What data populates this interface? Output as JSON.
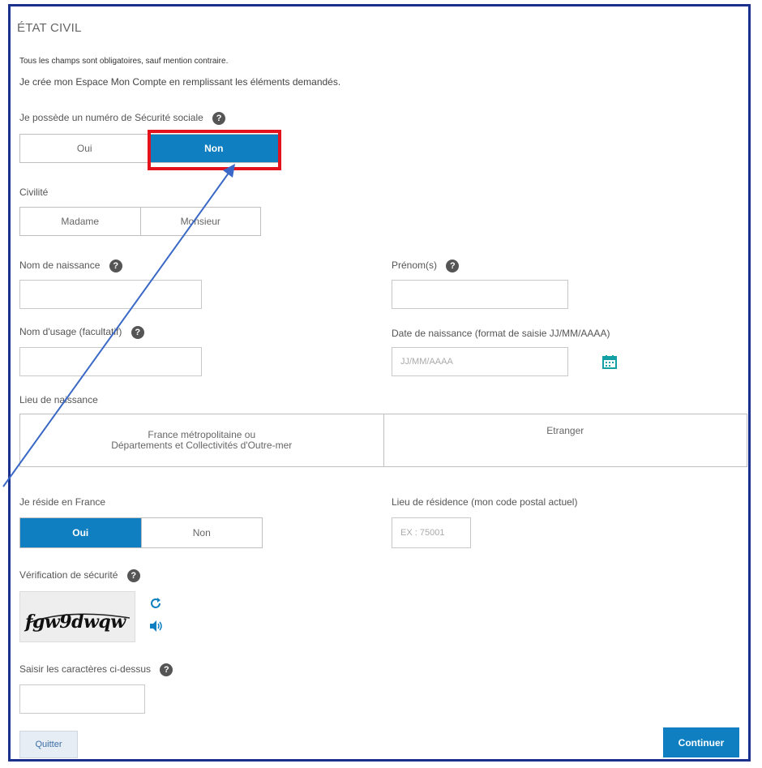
{
  "page": {
    "title": "ÉTAT CIVIL",
    "mandatory_note": "Tous les champs sont obligatoires, sauf mention contraire.",
    "intro": "Je crée mon Espace Mon Compte en remplissant les éléments demandés."
  },
  "social_security": {
    "question": "Je possède un numéro de Sécurité sociale",
    "yes": "Oui",
    "no": "Non",
    "selected": "no"
  },
  "civility": {
    "label": "Civilité",
    "madame": "Madame",
    "monsieur": "Monsieur"
  },
  "birth_name": {
    "label": "Nom de naissance",
    "value": ""
  },
  "first_names": {
    "label": "Prénom(s)",
    "value": ""
  },
  "usage_name": {
    "label": "Nom d'usage (facultatif)",
    "value": ""
  },
  "birth_date": {
    "label": "Date de naissance (format de saisie JJ/MM/AAAA)",
    "placeholder": "JJ/MM/AAAA",
    "icon": "calendar-icon"
  },
  "birth_place": {
    "label": "Lieu de naissance",
    "france_line1": "France métropolitaine ou",
    "france_line2": "Départements et Collectivités d'Outre-mer",
    "abroad": "Etranger"
  },
  "residence_france": {
    "label": "Je réside en France",
    "yes": "Oui",
    "no": "Non",
    "selected": "yes"
  },
  "residence_place": {
    "label": "Lieu de résidence (mon code postal actuel)",
    "placeholder": "EX : 75001"
  },
  "security": {
    "label": "Vérification de sécurité",
    "captcha_text": "fgw9dwqw",
    "refresh_icon": "refresh-icon",
    "audio_icon": "speaker-icon"
  },
  "captcha_input": {
    "label": "Saisir les caractères ci-dessus",
    "value": ""
  },
  "actions": {
    "quit": "Quitter",
    "continue": "Continuer"
  },
  "colors": {
    "accent": "#0f7fc1",
    "highlight": "#e3121d",
    "frame": "#1b2f8f",
    "arrow": "#3a68c6"
  }
}
